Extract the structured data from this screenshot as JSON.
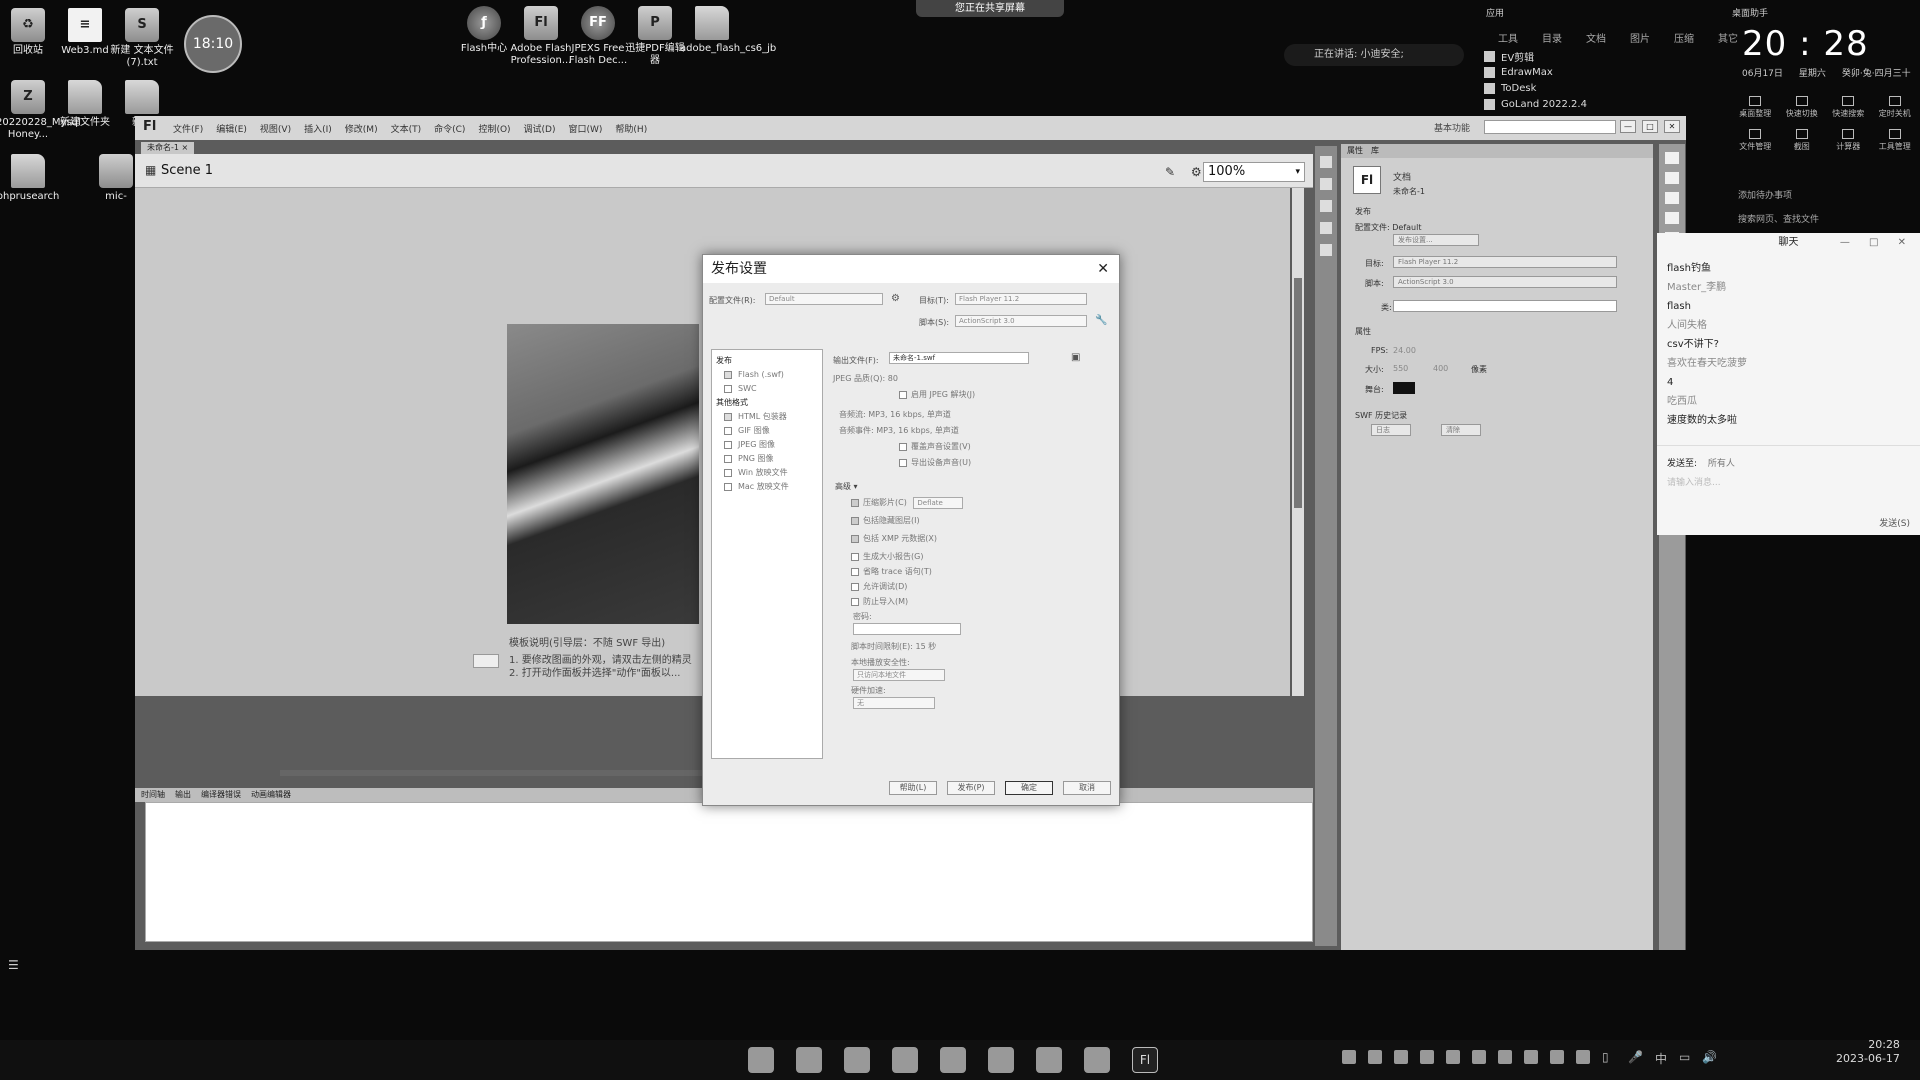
{
  "desktop": {
    "icons": [
      {
        "label": "回收站",
        "glyph": "♻"
      },
      {
        "label": "Web3.md",
        "glyph": "≡"
      },
      {
        "label": "新建 文本文件 (7).txt",
        "glyph": "S"
      },
      {
        "label": "Flash中心",
        "glyph": "ƒ"
      },
      {
        "label": "Adobe Flash Profession...",
        "glyph": "Fl"
      },
      {
        "label": "JPEXS Free Flash Dec...",
        "glyph": "FF"
      },
      {
        "label": "迅捷PDF编辑器",
        "glyph": "P"
      },
      {
        "label": "adobe_flash_cs6_jb",
        "glyph": ""
      },
      {
        "label": "20220228_Mysql Honey...",
        "glyph": "Z"
      },
      {
        "label": "新建文件夹",
        "glyph": ""
      },
      {
        "label": "新建",
        "glyph": ""
      },
      {
        "label": "phprusearch",
        "glyph": ""
      },
      {
        "label": "mic-",
        "glyph": ""
      }
    ],
    "clock_widget": "18:10",
    "share_banner": "您正在共享屏幕",
    "voice_status": "正在讲话: 小迪安全;"
  },
  "widgets": {
    "top_label": "应用",
    "desk_label": "桌面助手",
    "tabs": [
      "工具",
      "目录",
      "文档",
      "图片",
      "压缩",
      "其它"
    ],
    "apps": [
      "EV剪辑",
      "EdrawMax",
      "ToDesk",
      "GoLand 2022.2.4"
    ],
    "time": "20 : 28",
    "date": "06月17日",
    "weekday": "星期六",
    "lunar": "癸卯·兔·四月三十",
    "tools": [
      "桌面整理",
      "快速切换",
      "快速搜索",
      "定时关机",
      "文件管理",
      "截图",
      "计算器",
      "工具管理"
    ],
    "notes": "添加待办事项",
    "search_note": "搜索网页、查找文件"
  },
  "chat": {
    "title": "聊天",
    "messages": [
      {
        "text": "flash钓鱼",
        "muted": false
      },
      {
        "text": "Master_李鹏",
        "muted": true
      },
      {
        "text": "flash",
        "muted": false
      },
      {
        "text": "人间失格",
        "muted": true
      },
      {
        "text": "csv不讲下?",
        "muted": false
      },
      {
        "text": "喜欢在春天吃菠萝",
        "muted": true
      },
      {
        "text": "4",
        "muted": false
      },
      {
        "text": "吃西瓜",
        "muted": true
      },
      {
        "text": "速度数的太多啦",
        "muted": false
      }
    ],
    "send_to_label": "发送至:",
    "send_to_value": "所有人",
    "input_placeholder": "请输入消息...",
    "send_button": "发送(S)"
  },
  "app": {
    "logo": "Fl",
    "menu": [
      "文件(F)",
      "编辑(E)",
      "视图(V)",
      "插入(I)",
      "修改(M)",
      "文本(T)",
      "命令(C)",
      "控制(O)",
      "调试(D)",
      "窗口(W)",
      "帮助(H)"
    ],
    "workspace": "基本功能",
    "doc_tab": "未命名-1 ×",
    "scene": "Scene 1",
    "zoom": "100%",
    "stage_caption": "模板说明(引导层：不随 SWF 导出)",
    "stage_lines": [
      "1. 要修改图画的外观，请双击左侧的精灵",
      "2. 打开动作面板并选择\"动作\"面板以..."
    ],
    "bottom_tabs": [
      "时间轴",
      "输出",
      "编译器错误",
      "动画编辑器"
    ],
    "win_controls": [
      "—",
      "□",
      "✕"
    ]
  },
  "properties": {
    "tabs": [
      "属性",
      "库"
    ],
    "doc_type": "文档",
    "doc_name": "未命名-1",
    "section_publish": "发布",
    "profile_label": "配置文件: Default",
    "publish_settings_btn": "发布设置...",
    "target_label": "目标:",
    "target_value": "Flash Player 11.2",
    "script_label": "脚本:",
    "script_value": "ActionScript 3.0",
    "class_label": "类:",
    "section_props": "属性",
    "fps_label": "FPS:",
    "fps_value": "24.00",
    "size_label": "大小:",
    "size_w": "550",
    "size_h": "400",
    "size_unit": "像素",
    "stage_label": "舞台:",
    "history_label": "SWF 历史记录",
    "log_btn": "日志",
    "clear_btn": "清除"
  },
  "dialog": {
    "title": "发布设置",
    "profile_label": "配置文件(R):",
    "profile_value": "Default",
    "target_label": "目标(T):",
    "target_value": "Flash Player 11.2",
    "script_label": "脚本(S):",
    "script_value": "ActionScript 3.0",
    "left_header": "发布",
    "left_items": [
      {
        "label": "Flash (.swf)",
        "checked": true
      },
      {
        "label": "SWC",
        "checked": false
      }
    ],
    "other_header": "其他格式",
    "other_items": [
      {
        "label": "HTML 包装器",
        "checked": true
      },
      {
        "label": "GIF 图像",
        "checked": false
      },
      {
        "label": "JPEG 图像",
        "checked": false
      },
      {
        "label": "PNG 图像",
        "checked": false
      },
      {
        "label": "Win 放映文件",
        "checked": false
      },
      {
        "label": "Mac 放映文件",
        "checked": false
      }
    ],
    "output_label": "输出文件(F):",
    "output_value": "未命名-1.swf",
    "jpeg_quality": "JPEG 品质(Q): 80",
    "jpeg_deblock": "启用 JPEG 解块(J)",
    "audio_stream": "音频流: MP3, 16 kbps, 单声道",
    "audio_event": "音频事件: MP3, 16 kbps, 单声道",
    "override_sound": "覆盖声音设置(V)",
    "export_device": "导出设备声音(U)",
    "advanced": "高级 ▾",
    "options": [
      {
        "label": "压缩影片(C)",
        "checked": true,
        "extra": "Deflate"
      },
      {
        "label": "包括隐藏图层(I)",
        "checked": true,
        "extra": ""
      },
      {
        "label": "包括 XMP 元数据(X)",
        "checked": true,
        "extra": ""
      },
      {
        "label": "生成大小报告(G)",
        "checked": false,
        "extra": ""
      },
      {
        "label": "省略 trace 语句(T)",
        "checked": false,
        "extra": ""
      },
      {
        "label": "允许调试(D)",
        "checked": false,
        "extra": ""
      },
      {
        "label": "防止导入(M)",
        "checked": false,
        "extra": ""
      }
    ],
    "password_label": "密码:",
    "script_time_label": "脚本时间限制(E): 15 秒",
    "local_playback_label": "本地播放安全性:",
    "local_playback_value": "只访问本地文件",
    "hw_accel_label": "硬件加速:",
    "hw_accel_value": "无",
    "buttons": [
      "帮助(L)",
      "发布(P)",
      "确定",
      "取消"
    ]
  },
  "taskbar": {
    "time": "20:28",
    "date": "2023-06-17",
    "ime": "中",
    "active_app": "Fl"
  }
}
